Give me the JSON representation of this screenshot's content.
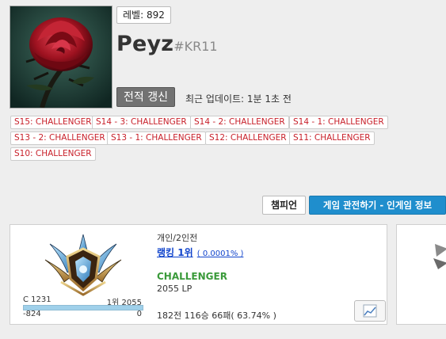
{
  "profile": {
    "level_badge": "레벨: 892",
    "name": "Peyz",
    "tag": "#KR11",
    "refresh_label": "전적 갱신",
    "last_update": "최근 업데이트: 1분 1초 전",
    "avatar_icon": "rose-icon"
  },
  "past_tiers": [
    "S15: CHALLENGER",
    "S14 - 3: CHALLENGER",
    "S14 - 2: CHALLENGER",
    "S14 - 1: CHALLENGER",
    "S13 - 2: CHALLENGER",
    "S13 - 1: CHALLENGER",
    "S12: CHALLENGER",
    "S11: CHALLENGER",
    "S10: CHALLENGER"
  ],
  "actions": {
    "champion_label": "챔피언",
    "spectate_label": "게임 관전하기 - 인게임 정보"
  },
  "rank": {
    "queue_type": "개인/2인전",
    "ranking_label": "랭킹 1위",
    "ranking_pct": "( 0.0001% )",
    "tier": "CHALLENGER",
    "lp": "2055 LP",
    "lp_lower_rank": "C 1231",
    "lp_upper_rank": "1위 2055",
    "lp_lower_diff": "-824",
    "lp_upper_diff": "0",
    "lp_progress": 1.0,
    "record": "182전 116승 66패( 63.74% )",
    "tier_color": "#3a9a3a",
    "emblem_icon": "challenger-emblem-icon",
    "graph_icon": "line-chart-icon"
  },
  "colors": {
    "accent_blue": "#1f8ecd",
    "badge_red": "#c8202a",
    "link_blue": "#1144cc"
  }
}
